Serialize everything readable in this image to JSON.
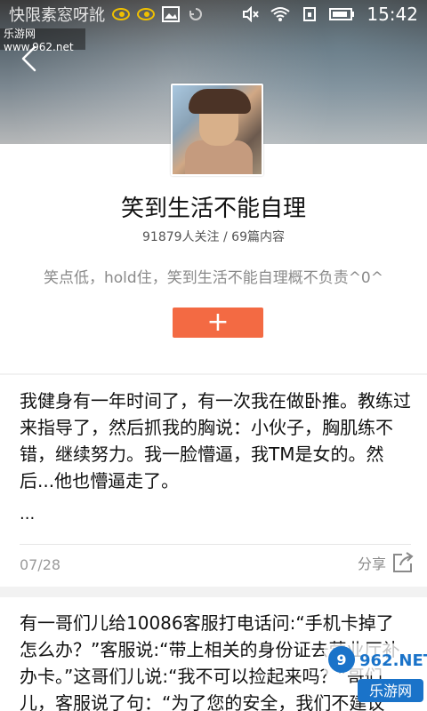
{
  "status_bar": {
    "title_text": "快限素窓呀訛",
    "time": "15:42",
    "icons": [
      "eye-icon",
      "eye-icon",
      "image-icon",
      "sync-icon",
      "mute-icon",
      "wifi-icon",
      "sim-icon",
      "battery-icon"
    ]
  },
  "profile": {
    "name": "笑到生活不能自理",
    "stats": "91879人关注 / 69篇内容",
    "description": "笑点低，hold住，笑到生活不能自理概不负责^0^",
    "follow_symbol": "+"
  },
  "posts": [
    {
      "text": "我健身有一年时间了，有一次我在做卧推。教练过来指导了，然后抓我的胸说：小伙子，胸肌练不错，继续努力。我一脸懵逼，我TM是女的。然后...他也懵逼走了。",
      "ellipsis": "...",
      "date": "07/28",
      "share_label": "分享"
    },
    {
      "text": "有一哥们儿给10086客服打电话问:“手机卡掉了怎么办？”客服说:“带上相关的身份证去营业厅补办卡。”这哥们儿说:“我不可以捡起来吗？”哥们儿，客服说了句：“为了您的安全，我们不建议"
    }
  ],
  "watermarks": {
    "top_left": "乐游网 www.962.net",
    "bottom_right_line1": "962.NET",
    "bottom_right_line2": "乐游网"
  },
  "colors": {
    "accent": "#f36a43",
    "watermark_blue": "#1a73c9"
  }
}
